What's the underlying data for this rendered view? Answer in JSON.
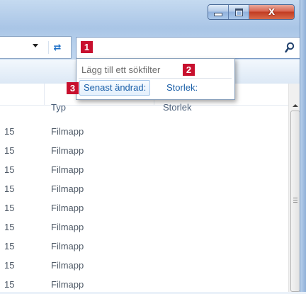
{
  "window": {
    "close_label": "X"
  },
  "badges": [
    "1",
    "2",
    "3"
  ],
  "search": {
    "value": "",
    "placeholder": ""
  },
  "suggestions": {
    "title": "Lägg till ett sökfilter",
    "filters": [
      "Senast ändrad:",
      "Storlek:"
    ]
  },
  "columns": {
    "type": "Typ",
    "size": "Storlek"
  },
  "rows": [
    {
      "date": "15",
      "type": "Filmapp"
    },
    {
      "date": "15",
      "type": "Filmapp"
    },
    {
      "date": "15",
      "type": "Filmapp"
    },
    {
      "date": "15",
      "type": "Filmapp"
    },
    {
      "date": "15",
      "type": "Filmapp"
    },
    {
      "date": "15",
      "type": "Filmapp"
    },
    {
      "date": "15",
      "type": "Filmapp"
    },
    {
      "date": "15",
      "type": "Filmapp"
    },
    {
      "date": "15",
      "type": "Filmapp"
    }
  ],
  "colors": {
    "accent": "#1a5fa8",
    "badge": "#c8102e"
  }
}
